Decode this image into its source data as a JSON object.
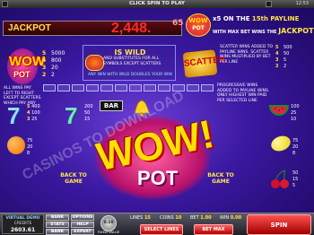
{
  "topbar": {
    "title": "CLICK SPIN TO PLAY",
    "clock": "12:53"
  },
  "jackpot": {
    "label": "JACKPOT",
    "amount": "2,448.",
    "amount_small": "65"
  },
  "payline_note": {
    "line1_prefix": "x5 ON THE ",
    "line1_highlight": "15th PAYLINE",
    "line2": "WITH MAX BET WINS THE ",
    "line2_highlight": "JACKPOT"
  },
  "wow_logo": {
    "text1": "WOW",
    "text2": "POT"
  },
  "wow_pay": {
    "counts": [
      "5",
      "4",
      "3",
      "2"
    ],
    "values": [
      "5000",
      "800",
      "20",
      "2"
    ]
  },
  "wild": {
    "title": "IS WILD",
    "body": "AND SUBSTITUTES FOR ALL SYMBOLS EXCEPT SCATTERS",
    "footer": "ANY WIN WITH WILD DOUBLES YOUR WIN"
  },
  "scatter": {
    "label": "SCATTER",
    "counts": [
      "5",
      "4",
      "3",
      "2"
    ],
    "values": [
      "500",
      "50",
      "5",
      "2"
    ],
    "note": "SCATTER WINS ADDED TO PAYLINE WINS. SCATTER WINS MULTIPLIED BY BET PER LINE"
  },
  "left_note": "ALL WINS PAY LEFT TO RIGHT EXCEPT SCATTERS WHICH PAY ANY",
  "right_note": "PROGRESSIVE WINS ADDED TO PAYLINE WINS. ONLY HIGHEST WIN PAID PER SELECTED LINE",
  "symbols": {
    "seven_pays": [
      "5",
      "4",
      "3"
    ],
    "seven_values": [
      "400",
      "100",
      "25"
    ],
    "seven2_values": [
      "200",
      "50",
      "15"
    ],
    "bar_label": "BAR",
    "melon_values": [
      "100",
      "25",
      "10"
    ],
    "orange_values": [
      "75",
      "20",
      "8"
    ],
    "lemon_values": [
      "75",
      "20",
      "8"
    ],
    "cherry_values": [
      "50",
      "15",
      "5"
    ]
  },
  "big_logo": {
    "text1": "WOW!",
    "text2": "POT"
  },
  "back_left": "BACK TO GAME",
  "back_right": "BACK TO GAME",
  "watermark": "CASINOS TO DOWNLOAD",
  "bottom": {
    "logo_line1": "VIRTUAL DEMO",
    "logo_line2": "CASINO",
    "credits_label": "CREDITS",
    "credits_value": "2603.61",
    "buttons": [
      "BANK",
      "OPTIONS",
      "STATS",
      "HELP",
      "BANK",
      "EXPERT"
    ],
    "coin_value": "0.10",
    "coin_label": "FIXED VALUE",
    "lines_label": "LINES",
    "lines_value": "15",
    "coins_label": "COINS",
    "coins_value": "10",
    "bet_label": "BET",
    "bet_value": "1.00",
    "win_label": "WIN",
    "win_value": "0.00",
    "select_lines": "SELECT LINES",
    "bet_max": "BET MAX",
    "spin": "SPIN"
  }
}
